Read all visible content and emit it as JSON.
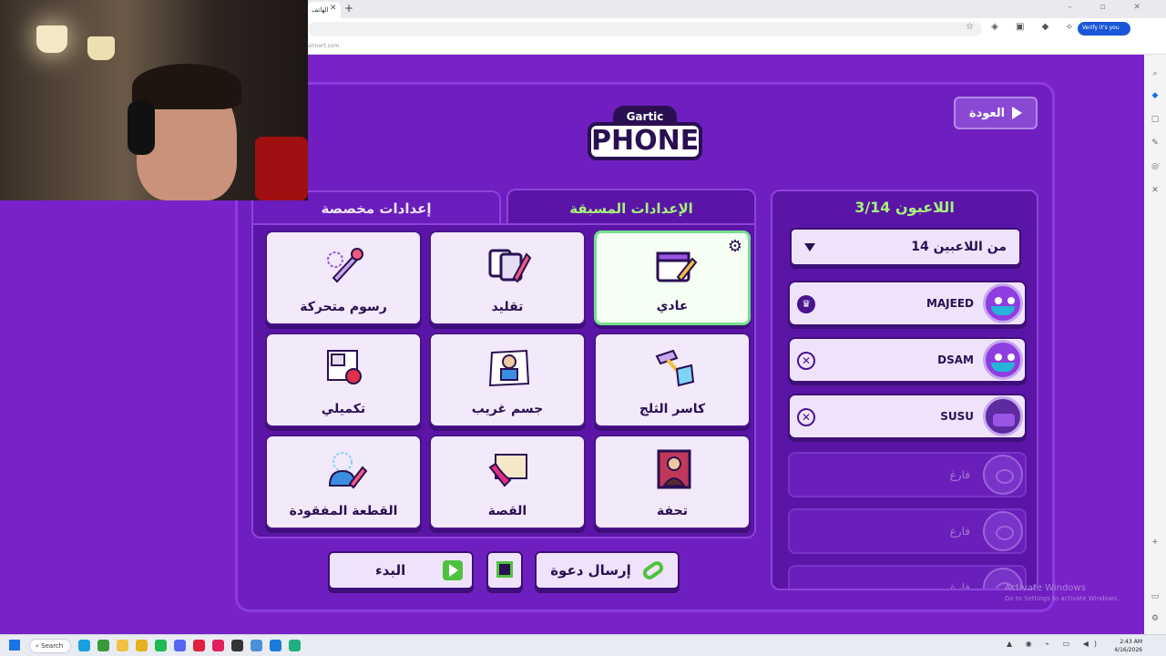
{
  "browser": {
    "tab_title": "الهاتف",
    "url_text": "almart.com",
    "verify_label": "Verify it's you",
    "icons": [
      "star-icon",
      "shield-icon",
      "extension-icon",
      "puzzle-icon",
      "sidebar-icon",
      "profile-icon",
      "menu-icon"
    ]
  },
  "game": {
    "back_label": "العودة",
    "logo_top": "Gartic",
    "logo_main": "PHONE",
    "tabs": {
      "custom": "إعدادات مخصصة",
      "preset": "الإعدادات المسبقة"
    },
    "modes": [
      {
        "label": "عادي",
        "icon": "calendar-pencil-icon",
        "selected": true
      },
      {
        "label": "تقليد",
        "icon": "cards-pencil-icon",
        "selected": false
      },
      {
        "label": "رسوم متحركة",
        "icon": "pin-brush-icon",
        "selected": false
      },
      {
        "label": "كاسر الثلج",
        "icon": "ice-hammer-icon",
        "selected": false
      },
      {
        "label": "جسم غريب",
        "icon": "strange-body-icon",
        "selected": false
      },
      {
        "label": "تكميلي",
        "icon": "puzzle-apple-icon",
        "selected": false
      },
      {
        "label": "تحفة",
        "icon": "mona-lisa-icon",
        "selected": false
      },
      {
        "label": "القصة",
        "icon": "scroll-quill-icon",
        "selected": false
      },
      {
        "label": "القطعة المفقودة",
        "icon": "missing-piece-icon",
        "selected": false
      }
    ],
    "start_label": "البدء",
    "invite_label": "إرسال دعوة",
    "players": {
      "title": "اللاعبون 3/14",
      "limit_label": "14 من اللاعبين",
      "list": [
        {
          "name": "MAJEED",
          "role": "host"
        },
        {
          "name": "DSAM",
          "role": "player"
        },
        {
          "name": "SUSU",
          "role": "player"
        }
      ],
      "empty_label": "فارغ"
    }
  },
  "watermark": {
    "title": "Activate Windows",
    "subtitle": "Go to Settings to activate Windows."
  },
  "taskbar": {
    "search_label": "Search",
    "time": "2:43 AM",
    "date": "4/16/2026"
  },
  "colors": {
    "background": "#7a22c9",
    "panel": "#5b15a6",
    "accent_green": "#a6f27a",
    "selected_border": "#74e08e"
  }
}
